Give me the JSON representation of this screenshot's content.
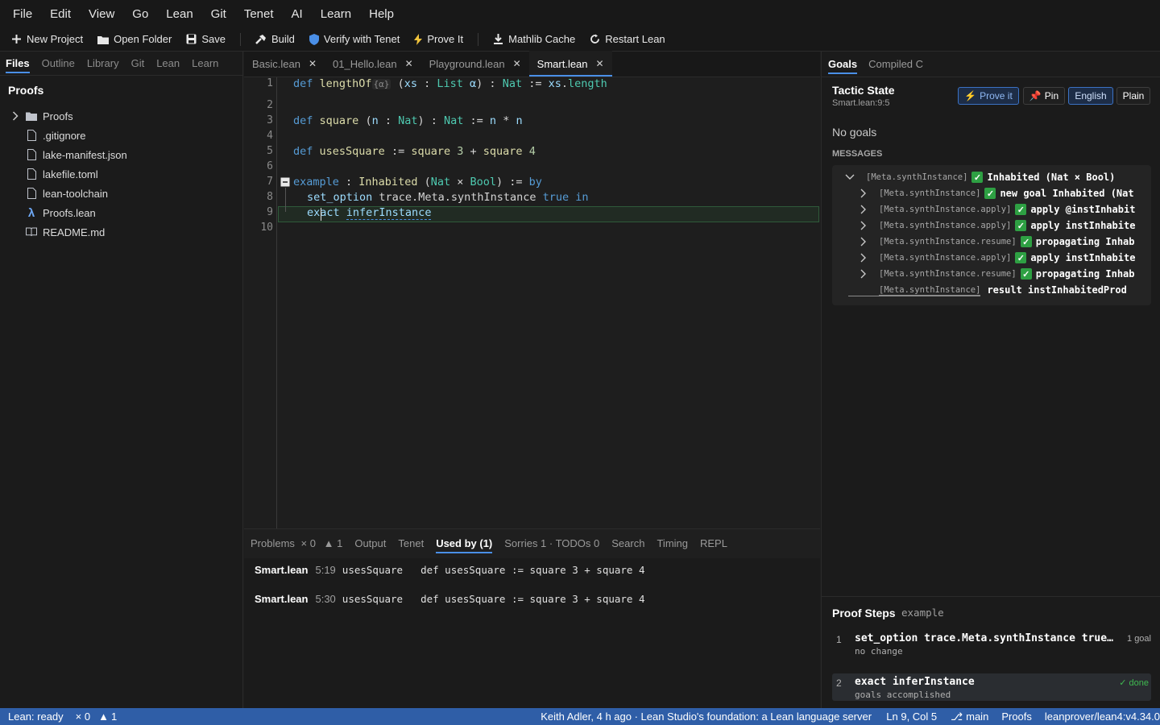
{
  "menu": [
    "File",
    "Edit",
    "View",
    "Go",
    "Lean",
    "Git",
    "Tenet",
    "AI",
    "Learn",
    "Help"
  ],
  "toolbar": {
    "new_project": "New Project",
    "open_folder": "Open Folder",
    "save": "Save",
    "build": "Build",
    "verify": "Verify with Tenet",
    "prove": "Prove It",
    "mathlib": "Mathlib Cache",
    "restart": "Restart Lean"
  },
  "sidebar": {
    "tabs": [
      "Files",
      "Outline",
      "Library",
      "Git",
      "Lean",
      "Learn"
    ],
    "active_tab": "Files",
    "title": "Proofs",
    "items": [
      {
        "label": "Proofs",
        "type": "folder",
        "icon": "folder-icon"
      },
      {
        "label": ".gitignore",
        "type": "file",
        "icon": "file-icon"
      },
      {
        "label": "lake-manifest.json",
        "type": "file",
        "icon": "file-icon"
      },
      {
        "label": "lakefile.toml",
        "type": "file",
        "icon": "file-icon"
      },
      {
        "label": "lean-toolchain",
        "type": "file",
        "icon": "file-icon"
      },
      {
        "label": "Proofs.lean",
        "type": "file",
        "icon": "lambda-icon"
      },
      {
        "label": "README.md",
        "type": "file",
        "icon": "book-icon"
      }
    ]
  },
  "editor": {
    "tabs": [
      {
        "label": "Basic.lean",
        "active": false
      },
      {
        "label": "01_Hello.lean",
        "active": false
      },
      {
        "label": "Playground.lean",
        "active": false
      },
      {
        "label": "Smart.lean",
        "active": true
      }
    ],
    "line_numbers": [
      "1",
      "2",
      "3",
      "4",
      "5",
      "6",
      "7",
      "8",
      "9",
      "10"
    ],
    "inlay_hint": "{α}"
  },
  "bottom_panel": {
    "tabs": [
      "Problems",
      "Output",
      "Tenet",
      "Used by (1)",
      "Sorries 1 · TODOs 0",
      "Search",
      "Timing",
      "REPL"
    ],
    "problems_errors": "× 0",
    "problems_warnings": "1",
    "active_tab": "Used by (1)",
    "references": [
      {
        "file": "Smart.lean",
        "pos": "5:19",
        "name": "usesSquare",
        "code": "def usesSquare := square 3 + square 4"
      },
      {
        "file": "Smart.lean",
        "pos": "5:30",
        "name": "usesSquare",
        "code": "def usesSquare := square 3 + square 4"
      }
    ]
  },
  "right_panel": {
    "tabs": [
      "Goals",
      "Compiled C"
    ],
    "active_tab": "Goals",
    "tactic_title": "Tactic State",
    "tactic_loc": "Smart.lean:9:5",
    "buttons": {
      "prove": "Prove it",
      "pin": "Pin",
      "english": "English",
      "plain": "Plain"
    },
    "no_goals": "No goals",
    "messages_label": "MESSAGES",
    "messages": [
      {
        "tag": "[Meta.synthInstance]",
        "text": "Inhabited (Nat × Bool)",
        "check": true,
        "expanded": true,
        "indent": 0
      },
      {
        "tag": "[Meta.synthInstance]",
        "text": "new goal Inhabited (Nat",
        "check": true,
        "expanded": false,
        "indent": 1
      },
      {
        "tag": "[Meta.synthInstance.apply]",
        "text": "apply @instInhabit",
        "check": true,
        "expanded": false,
        "indent": 1
      },
      {
        "tag": "[Meta.synthInstance.apply]",
        "text": "apply instInhabite",
        "check": true,
        "expanded": false,
        "indent": 1
      },
      {
        "tag": "[Meta.synthInstance.resume]",
        "text": "propagating Inhab",
        "check": true,
        "expanded": false,
        "indent": 1
      },
      {
        "tag": "[Meta.synthInstance.apply]",
        "text": "apply instInhabite",
        "check": true,
        "expanded": false,
        "indent": 1
      },
      {
        "tag": "[Meta.synthInstance.resume]",
        "text": "propagating Inhab",
        "check": true,
        "expanded": false,
        "indent": 1
      },
      {
        "tag": "[Meta.synthInstance]",
        "text": "result instInhabitedProd",
        "check": false,
        "expanded": false,
        "indent": 1
      }
    ],
    "proof_steps": {
      "title": "Proof Steps",
      "subtitle": "example",
      "steps": [
        {
          "num": "1",
          "code": "set_option trace.Meta.synthInstance true…",
          "note": "no change",
          "status": "1 goal"
        },
        {
          "num": "2",
          "code": "exact inferInstance",
          "note": "goals accomplished",
          "status": "✓ done"
        }
      ]
    }
  },
  "status": {
    "lean": "Lean: ready",
    "errors": "× 0",
    "warnings": "1",
    "commit": "Keith Adler, 4 h ago · Lean Studio's foundation: a Lean language server ...",
    "position": "Ln 9, Col 5",
    "branch": "main",
    "project": "Proofs",
    "toolchain": "leanprover/lean4:v4.34.0"
  },
  "colors": {
    "accent": "#4a8fe7",
    "statusbar": "#2f5ea7",
    "success": "#2ea043"
  }
}
